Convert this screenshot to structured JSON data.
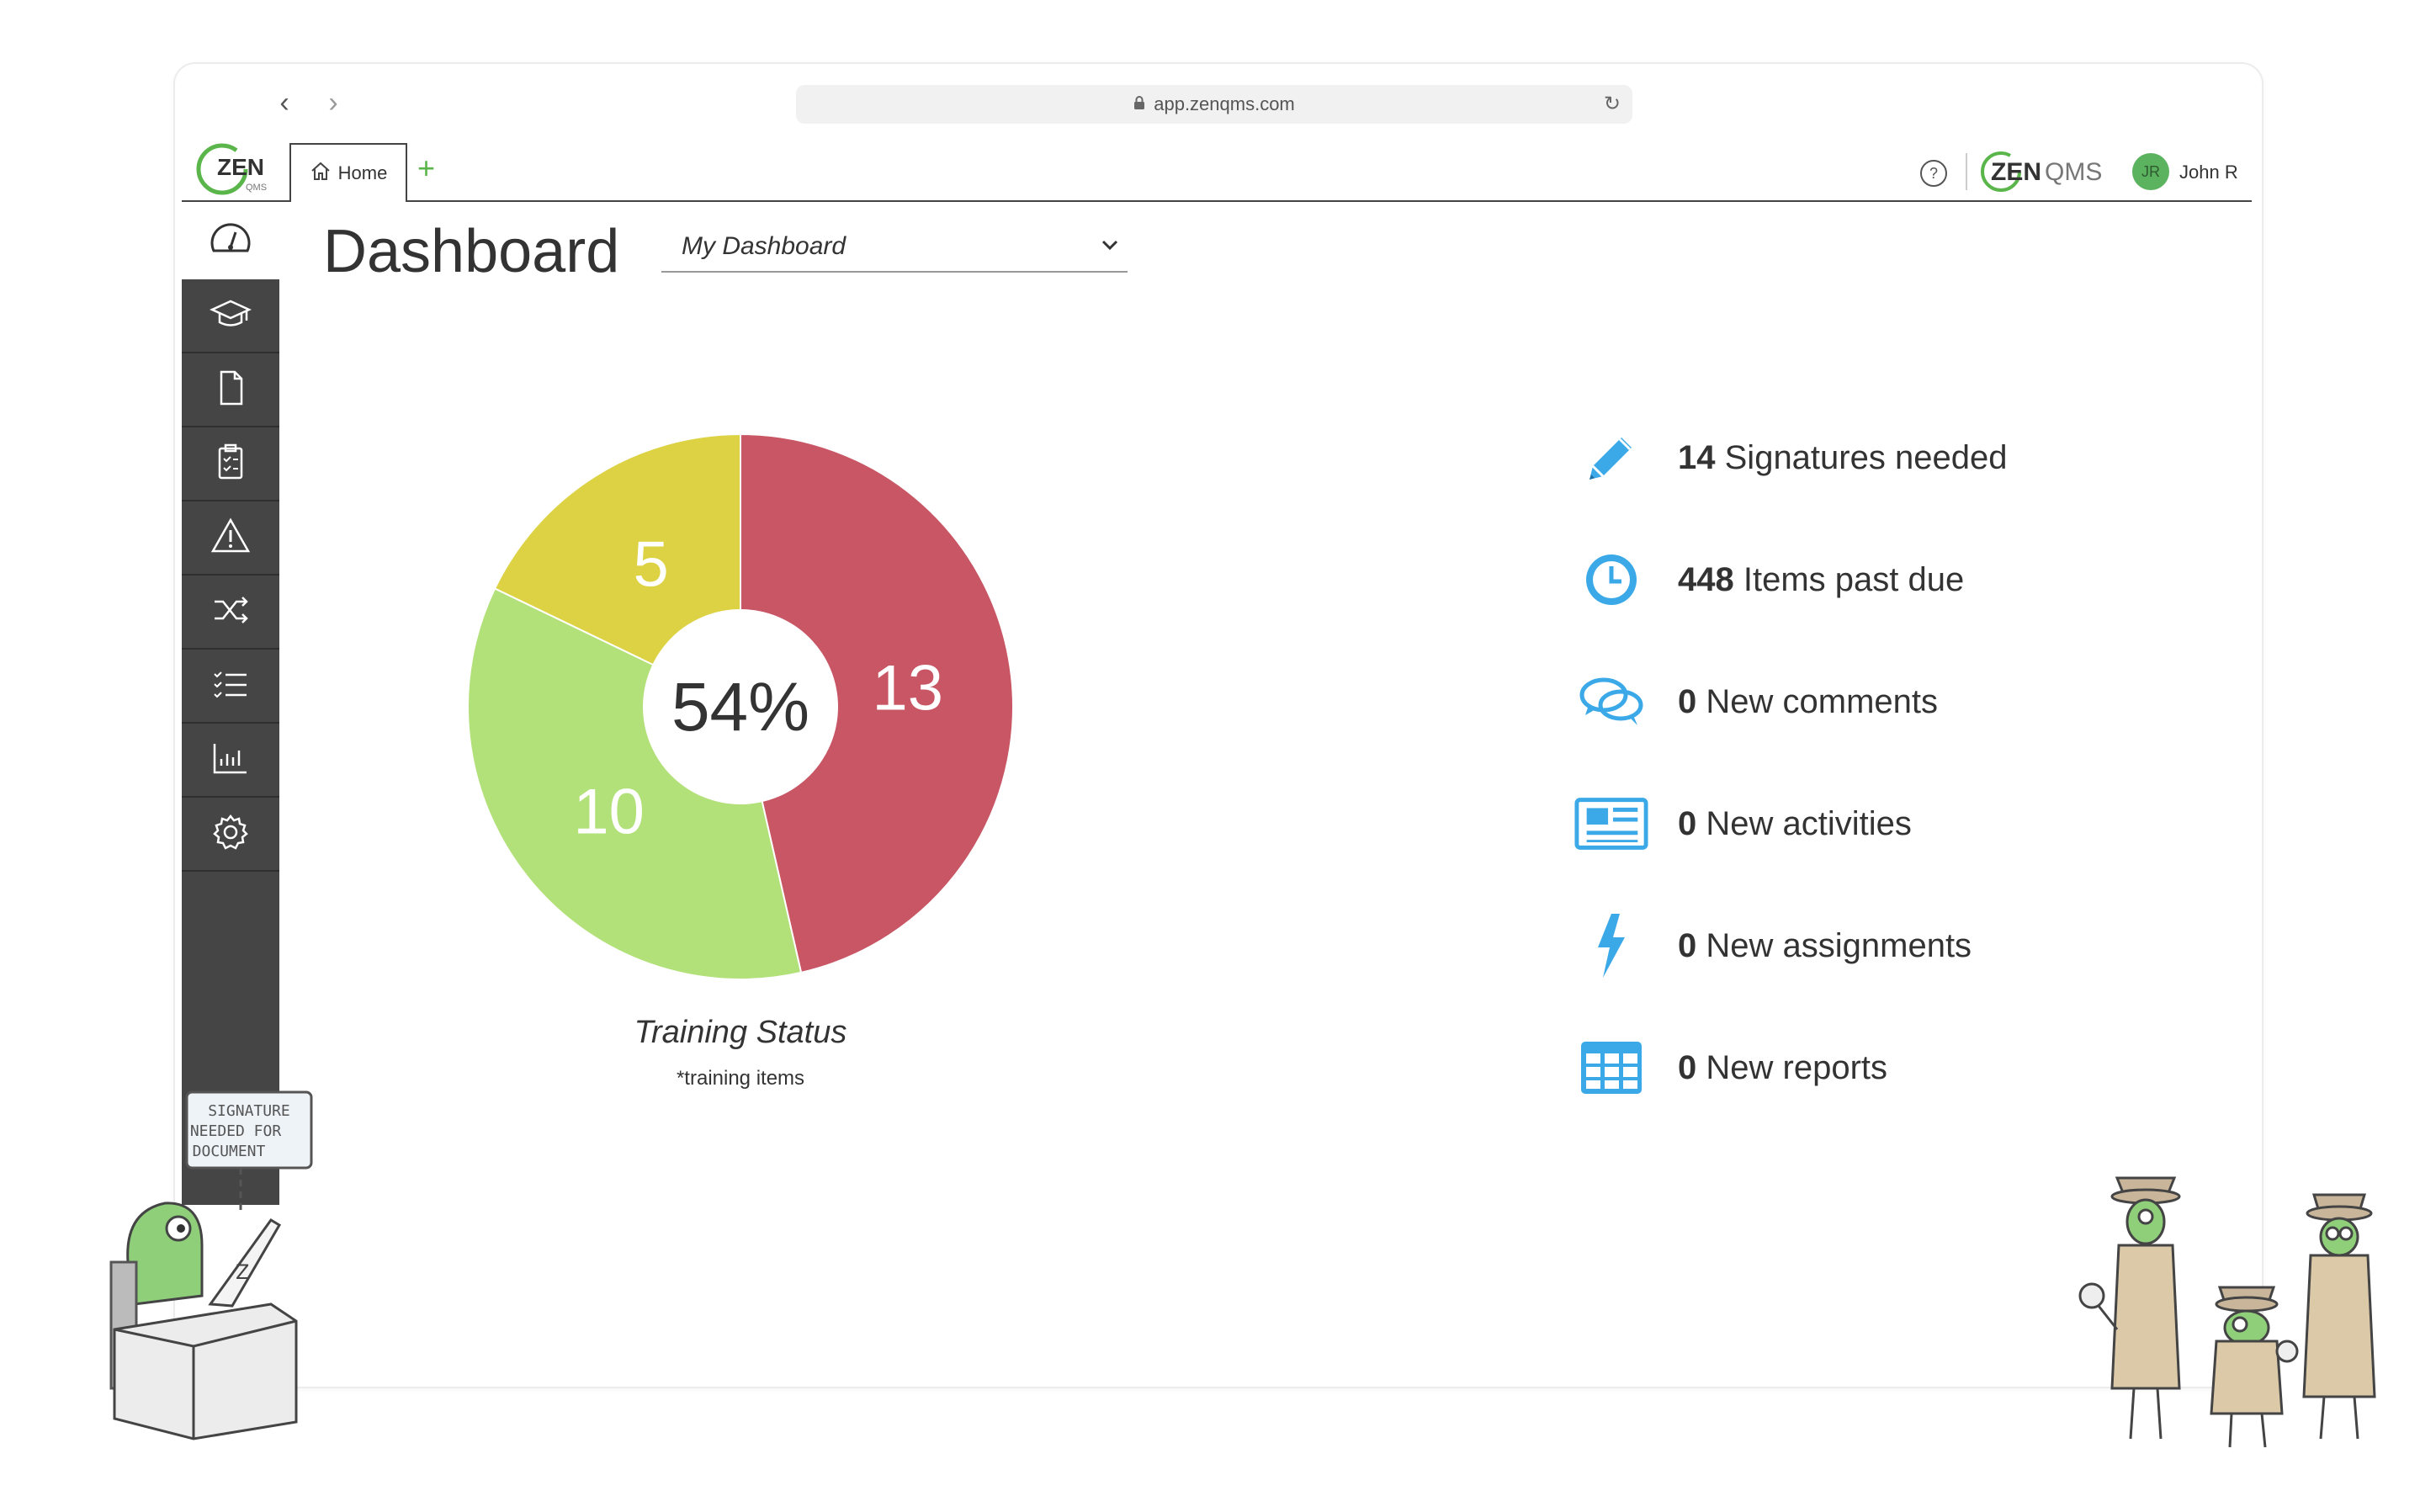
{
  "browser": {
    "url": "app.zenqms.com",
    "back_label": "‹",
    "forward_label": "›"
  },
  "header": {
    "logo_text": "ZEN",
    "logo_sub": "QMS",
    "home_tab": "Home",
    "add_tab": "+",
    "help": "?",
    "brand_text_1": "ZEN",
    "brand_text_2": "QMS",
    "avatar_initials": "JR",
    "user_name": "John R"
  },
  "sidebar": {
    "items": [
      {
        "icon": "dashboard-gauge-icon"
      },
      {
        "icon": "training-cap-icon"
      },
      {
        "icon": "document-icon"
      },
      {
        "icon": "clipboard-checklist-icon"
      },
      {
        "icon": "warning-triangle-icon"
      },
      {
        "icon": "shuffle-icon"
      },
      {
        "icon": "task-list-icon"
      },
      {
        "icon": "reports-chart-icon"
      },
      {
        "icon": "settings-gear-icon"
      }
    ]
  },
  "main": {
    "title": "Dashboard",
    "dashboard_select": "My Dashboard"
  },
  "chart_data": {
    "type": "pie",
    "center_label": "54%",
    "categories": [
      "red",
      "green",
      "yellow"
    ],
    "values": [
      13,
      10,
      5
    ],
    "colors": [
      "#c85664",
      "#b2e079",
      "#dcd243"
    ],
    "title": "Training Status",
    "subtitle": "*training items"
  },
  "stats": [
    {
      "icon": "pencil-icon",
      "count": "14",
      "label": "Signatures needed",
      "color": "#3ba9e8"
    },
    {
      "icon": "clock-icon",
      "count": "448",
      "label": "Items past due",
      "color": "#3ba9e8"
    },
    {
      "icon": "comments-icon",
      "count": "0",
      "label": "New comments",
      "color": "#3ba9e8"
    },
    {
      "icon": "newspaper-icon",
      "count": "0",
      "label": "New activities",
      "color": "#3ba9e8"
    },
    {
      "icon": "lightning-icon",
      "count": "0",
      "label": "New assignments",
      "color": "#3ba9e8"
    },
    {
      "icon": "table-grid-icon",
      "count": "0",
      "label": "New reports",
      "color": "#3ba9e8"
    }
  ],
  "illustration": {
    "sign_text": "SIGNATURE NEEDED FOR DOCUMENT",
    "laptop_letter": "Z"
  }
}
